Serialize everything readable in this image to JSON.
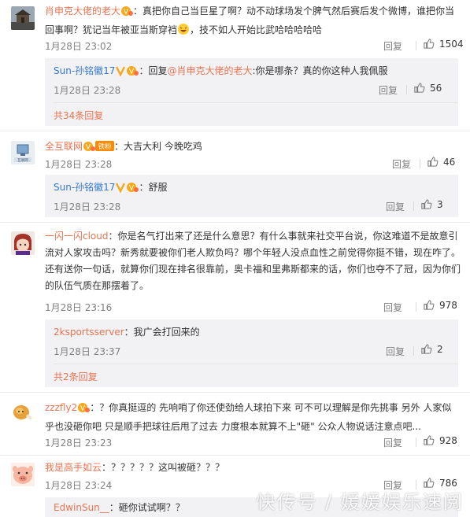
{
  "comments": [
    {
      "user": "肖申克大佬的老大",
      "text_a": "：真把你自己当巨星了啊？动不动球场发个脾气然后赛后发个微博，谁把你当回事啊？犹记当年被亚当斯穿裆",
      "text_b": "，技不如人开始比武哈哈哈哈哈",
      "time": "1月28日 23:02",
      "reply_label": "回复",
      "likes": "1504",
      "replies": [
        {
          "user": "Sun-孙铭徽17",
          "mid": "：回复",
          "reply_to": "@肖申克大佬的老大",
          "text": ":你是哪条？真的你这种人我佩服",
          "time": "1月28日 23:28",
          "reply_label": "回复",
          "likes": "56"
        }
      ],
      "more": "共34条回复"
    },
    {
      "user": "全互联网",
      "badge": "铁粉",
      "text": "：大吉大利 今晚吃鸡",
      "time": "1月28日 23:28",
      "reply_label": "回复",
      "likes": "46",
      "replies": [
        {
          "user": "Sun-孙铭徽17",
          "text": "：舒服",
          "time": "1月28日 23:28",
          "reply_label": "回复",
          "likes": "3"
        }
      ]
    },
    {
      "user": "一闪一闪cloud",
      "text": "：你是名气打出来了还是什么意思？有什么事就来社交平台说，你这难道不是故意引流对人家攻击吗？新秀就要被你们老人欺负吗？哪个年轻人没点血性之前觉得你挺不错，现在咋了。还有送你一句话，就算你们现在排名很靠前，奥卡福和里弗斯都来的话，你们也夺不了冠，因为你们的队伍气质在那摆着了。",
      "time": "1月28日 23:16",
      "reply_label": "回复",
      "likes": "978",
      "replies": [
        {
          "user": "2ksportsserver",
          "text": "：我广会打回来的",
          "time": "1月28日 23:37",
          "reply_label": "回复",
          "likes": "2"
        }
      ],
      "more": "共2条回复"
    },
    {
      "user": "zzzfly2",
      "text": "：？你真挺逗的 先响哨了你还使劲给人球拍下来 可不可以理解是你先挑事 另外 人家似乎也没砸你吧 只是顺手把球往后甩了过去 力度根本就算不上\"砸\" 公众人物说话注意点吧...",
      "time": "1月28日 23:23",
      "reply_label": "回复",
      "likes": "928"
    },
    {
      "user": "我是高手如云",
      "text": "：？？？？？这叫被砸？？？",
      "time": "1月28日 23:24",
      "reply_label": "回复",
      "likes": "786",
      "replies": [
        {
          "user": "EdwinSun__",
          "text": "：砸你试试啊？？"
        }
      ]
    }
  ],
  "watermark": "快传号 / 媛媛娱乐速阅",
  "colors": {
    "username": "#eb7350",
    "username_blue": "#3377cc",
    "subbox_bg": "#f2f2f5",
    "meta": "#808080",
    "vip_gold": "#f7a81b"
  }
}
